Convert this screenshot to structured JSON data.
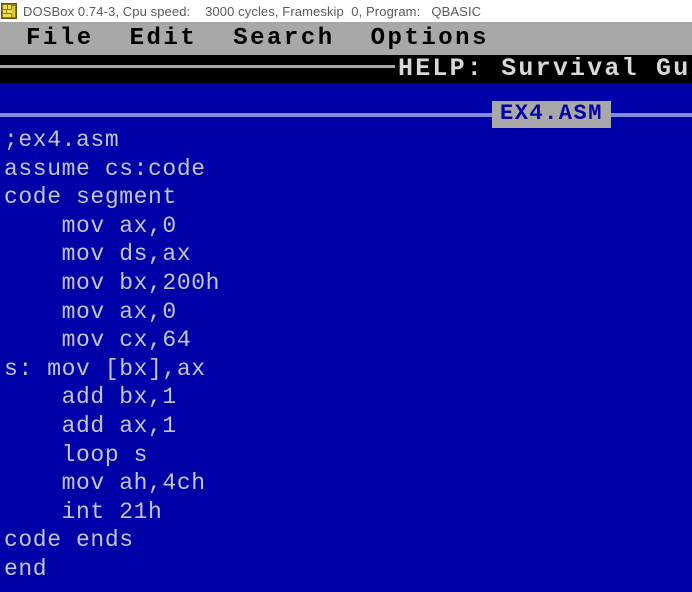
{
  "window": {
    "titlebar_text": "DOSBox 0.74-3, Cpu speed:    3000 cycles, Frameskip  0, Program:   QBASIC",
    "icon": "dosbox-app-icon",
    "titlebar_bg": "#ffffff",
    "titlebar_fg": "#5a5a5a"
  },
  "colors": {
    "dos_background": "#0000a8",
    "menubar_background": "#a8a8a8",
    "menubar_text": "#000000",
    "helpbar_background": "#000000",
    "helpbar_text": "#d8d8d8",
    "code_text": "#c4c4cc",
    "window_frame_line": "#8888d8",
    "window_title_background": "#a8a8a8",
    "window_title_text": "#0000a8"
  },
  "menubar": {
    "items": [
      {
        "label": "File"
      },
      {
        "label": "Edit"
      },
      {
        "label": "Search"
      },
      {
        "label": "Options"
      }
    ]
  },
  "helpbar": {
    "text": "HELP: Survival Guide"
  },
  "editor": {
    "window_title": "EX4.ASM",
    "lines": [
      ";ex4.asm",
      "assume cs:code",
      "code segment",
      "    mov ax,0",
      "    mov ds,ax",
      "    mov bx,200h",
      "    mov ax,0",
      "    mov cx,64",
      "s: mov [bx],ax",
      "    add bx,1",
      "    add ax,1",
      "    loop s",
      "    mov ah,4ch",
      "    int 21h",
      "code ends",
      "end"
    ]
  }
}
